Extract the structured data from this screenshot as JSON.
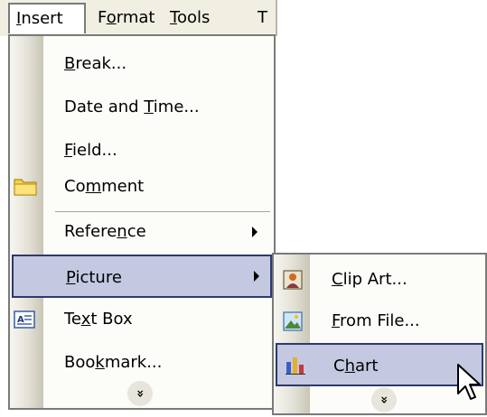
{
  "menubar": {
    "items": [
      {
        "key": "I",
        "rest": "nsert"
      },
      {
        "pre": "F",
        "key": "o",
        "rest": "rmat"
      },
      {
        "key": "T",
        "rest": "ools"
      },
      {
        "rest": "T"
      }
    ]
  },
  "insert_menu": {
    "break": {
      "key": "B",
      "rest": "reak..."
    },
    "date_time": {
      "pre": "Date and ",
      "key": "T",
      "rest": "ime..."
    },
    "field": {
      "key": "F",
      "rest": "ield..."
    },
    "comment": {
      "pre": "Co",
      "key": "m",
      "rest": "ment"
    },
    "reference": {
      "pre": "Refere",
      "key": "n",
      "rest": "ce"
    },
    "picture": {
      "key": "P",
      "rest": "icture"
    },
    "text_box": {
      "pre": "Te",
      "key": "x",
      "rest": "t Box"
    },
    "bookmark": {
      "pre": "Boo",
      "key": "k",
      "rest": "mark..."
    },
    "expand_glyph": "»"
  },
  "picture_submenu": {
    "clip_art": {
      "key": "C",
      "rest": "lip Art..."
    },
    "from_file": {
      "key": "F",
      "rest": "rom File..."
    },
    "chart": {
      "pre": "C",
      "key": "h",
      "rest": "art"
    },
    "expand_glyph": "»"
  },
  "colors": {
    "highlight": "#c4c8e1",
    "highlight_border": "#2d3a6e",
    "menubar": "#f1efe2"
  }
}
